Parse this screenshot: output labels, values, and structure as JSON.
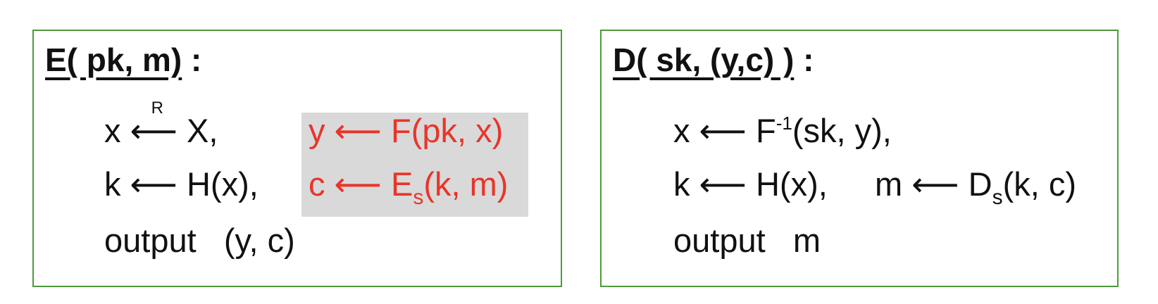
{
  "encrypt": {
    "title_underlined": "E( pk, m)",
    "title_suffix": " :",
    "line1": {
      "var": "x",
      "arrow": "⟵",
      "r_label": "R",
      "rest": " X,"
    },
    "line1_right": "y ⟵ F(pk, x)",
    "line2": "k ⟵ H(x),",
    "line2_right_prefix": "c ⟵ E",
    "line2_right_sub": "s",
    "line2_right_suffix": "(k, m)",
    "line3": "output   (y, c)",
    "highlight_color": "#d9d9d9",
    "highlight_text_color": "#e8352a"
  },
  "decrypt": {
    "title_underlined": "D( sk, (y,c) )",
    "title_suffix": " :",
    "line1_prefix": "x ⟵ F",
    "line1_sup": "-1",
    "line1_suffix": "(sk, y),",
    "line2_left": "k ⟵ H(x),",
    "line2_right_prefix": "m ⟵ D",
    "line2_right_sub": "s",
    "line2_right_suffix": "(k, c)",
    "line3": "output   m"
  },
  "border_color": "#4d9a3c"
}
